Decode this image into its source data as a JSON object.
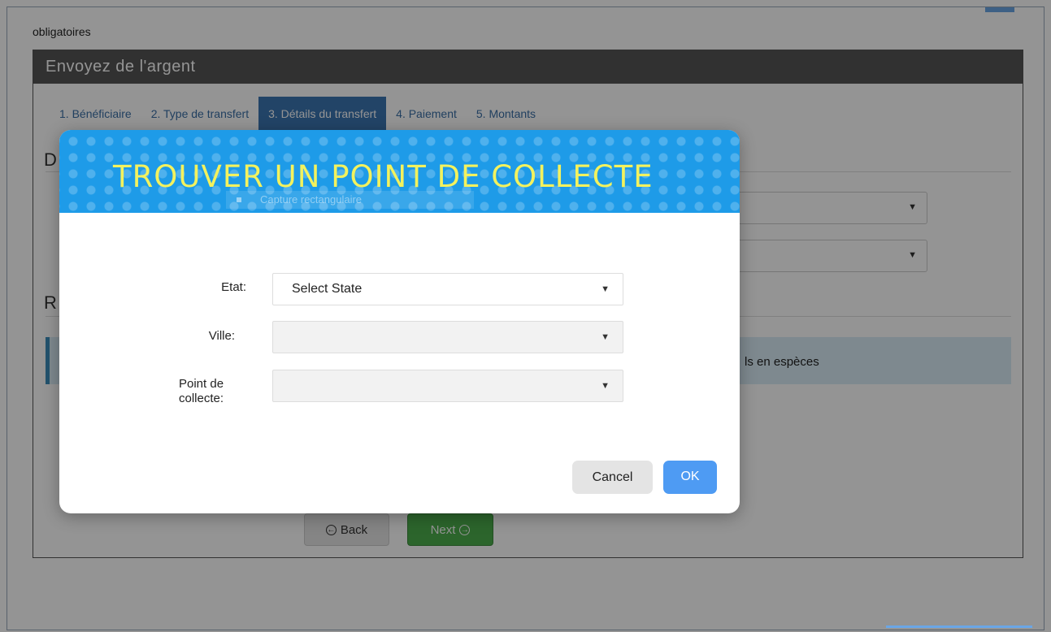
{
  "page": {
    "top_note": "obligatoires"
  },
  "panel": {
    "title": "Envoyez de l'argent",
    "tabs": [
      {
        "label": "1. Bénéficiaire",
        "active": false
      },
      {
        "label": "2. Type de transfert",
        "active": false
      },
      {
        "label": "3. Détails du transfert",
        "active": true
      },
      {
        "label": "4. Paiement",
        "active": false
      },
      {
        "label": "5. Montants",
        "active": false
      }
    ],
    "section1_letter": "D",
    "section2_letter": "R",
    "info_text": "ls en espèces",
    "back_label": "Back",
    "next_label": "Next"
  },
  "modal": {
    "title": "TROUVER UN POINT DE COLLECTE",
    "snip_label": "Capture rectangulaire",
    "fields": {
      "state_label": "Etat:",
      "state_value": "Select State",
      "city_label": "Ville:",
      "city_value": "",
      "point_label_1": "Point de",
      "point_label_2": "collecte:",
      "point_value": ""
    },
    "cancel_label": "Cancel",
    "ok_label": "OK"
  },
  "colors": {
    "header_blue": "#1e9be8",
    "title_yellow": "#f3f25e",
    "ok_blue": "#4e9bf3",
    "next_green": "#4cae4c",
    "active_tab": "#3c76b1"
  },
  "icons": {
    "back": "arrow-left-circle-icon",
    "next": "arrow-right-circle-icon",
    "dropdown": "caret-down-icon"
  }
}
